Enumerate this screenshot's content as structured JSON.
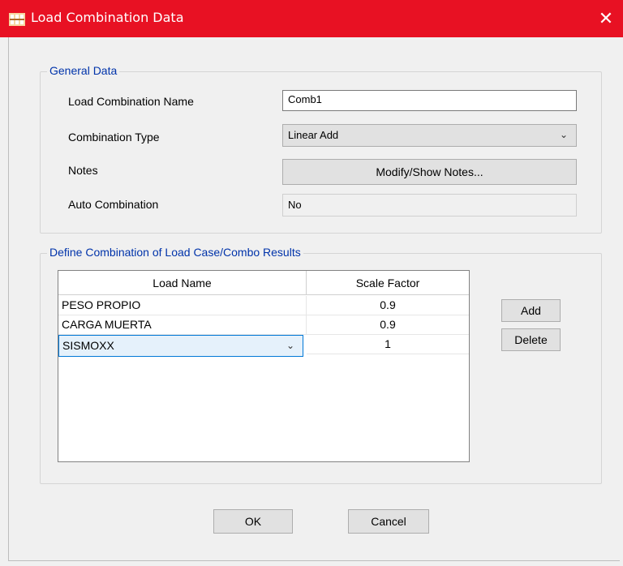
{
  "window": {
    "title": "Load Combination Data",
    "close_glyph": "✕",
    "titlebar_color": "#e81123",
    "app_icon": "etabs-app-icon"
  },
  "general_data": {
    "legend": "General Data",
    "name_label": "Load Combination Name",
    "name_value": "Comb1",
    "type_label": "Combination Type",
    "type_value": "Linear Add",
    "notes_label": "Notes",
    "notes_button": "Modify/Show Notes...",
    "auto_label": "Auto Combination",
    "auto_value": "No"
  },
  "define": {
    "legend": "Define Combination of Load Case/Combo Results",
    "columns": [
      "Load Name",
      "Scale Factor"
    ],
    "rows": [
      {
        "load_name": "PESO PROPIO",
        "scale_factor": "0.9"
      },
      {
        "load_name": "CARGA MUERTA",
        "scale_factor": "0.9"
      },
      {
        "load_name": "SISMOXX",
        "scale_factor": "1"
      }
    ],
    "add_button": "Add",
    "delete_button": "Delete"
  },
  "footer": {
    "ok_button": "OK",
    "cancel_button": "Cancel"
  },
  "icons": {
    "chevron": "chevron-down-icon"
  }
}
